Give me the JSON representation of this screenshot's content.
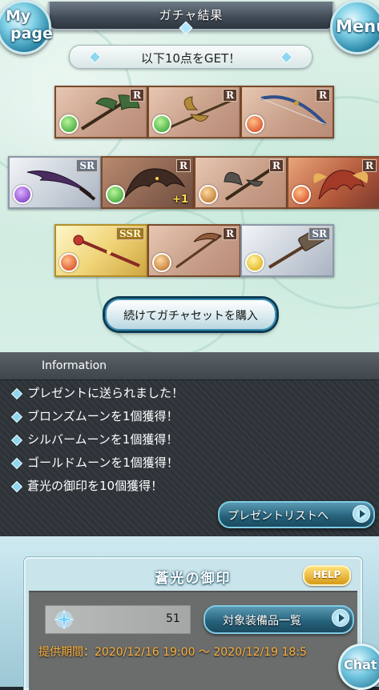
{
  "header": {
    "title": "ガチャ結果",
    "mypage_line1": "My",
    "mypage_line2": "page",
    "menu_label": "Menu"
  },
  "result": {
    "banner": "以下10点をGET！",
    "items": [
      {
        "rarity": "R",
        "element": "wind",
        "icon": "axe-icon",
        "bonus": ""
      },
      {
        "rarity": "R",
        "element": "wind",
        "icon": "halberd-icon",
        "bonus": ""
      },
      {
        "rarity": "R",
        "element": "fire",
        "icon": "bow-icon",
        "bonus": ""
      },
      {
        "rarity": "SR",
        "element": "dark",
        "icon": "dark-blade-icon",
        "bonus": ""
      },
      {
        "rarity": "R",
        "element": "wind",
        "icon": "summon-creature-icon",
        "bonus": "+1"
      },
      {
        "rarity": "R",
        "element": "earth",
        "icon": "battle-axe-icon",
        "bonus": ""
      },
      {
        "rarity": "R",
        "element": "fire",
        "icon": "summon-creature-icon",
        "bonus": ""
      },
      {
        "rarity": "SSR",
        "element": "fire",
        "icon": "staff-icon",
        "bonus": ""
      },
      {
        "rarity": "R",
        "element": "earth",
        "icon": "scythe-icon",
        "bonus": ""
      },
      {
        "rarity": "SR",
        "element": "light",
        "icon": "hammer-icon",
        "bonus": ""
      }
    ],
    "continue_label": "続けてガチャセットを購入"
  },
  "info": {
    "title": "Information",
    "lines": [
      "プレゼントに送られました！",
      "ブロンズムーンを1個獲得！",
      "シルバームーンを1個獲得！",
      "ゴールドムーンを1個獲得！",
      "蒼光の御印を10個獲得！"
    ],
    "present_button": "プレゼントリストへ"
  },
  "seal": {
    "title": "蒼光の御印",
    "help_label": "HELP",
    "count": "51",
    "equip_button": "対象装備品一覧",
    "period": "提供期間：2020/12/16 19:00 ～ 2020/12/19 18:5"
  },
  "chat_label": "Chat",
  "colors": {
    "accent_blue": "#245f78",
    "period_text": "#ffb23b",
    "help_gold": "#d69a17"
  }
}
